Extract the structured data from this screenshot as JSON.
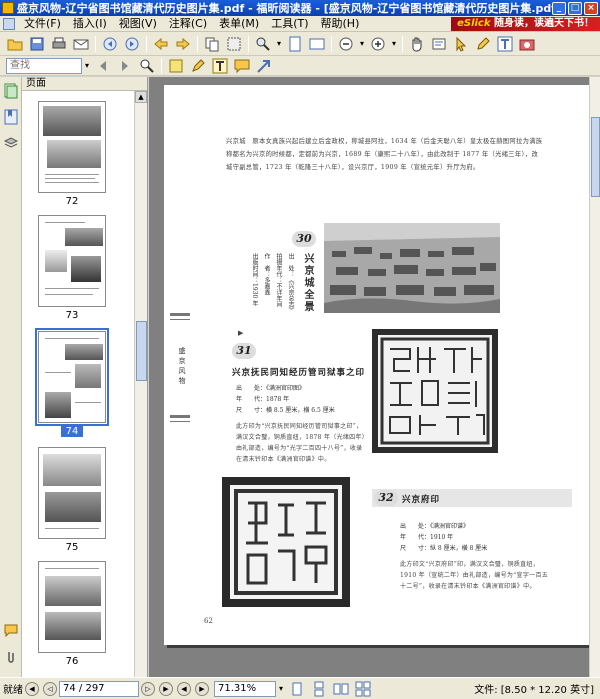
{
  "window": {
    "title": "盛京风物-辽宁省图书馆藏清代历史图片集.pdf - 福昕阅读器 - [盛京风物-辽宁省图书馆藏清代历史图片集.pdf]",
    "minimize": "_",
    "maximize": "□",
    "close": "×"
  },
  "menu": {
    "items": [
      "文件(F)",
      "插入(I)",
      "视图(V)",
      "注释(C)",
      "表单(M)",
      "工具(T)",
      "帮助(H)"
    ],
    "promo_brand": "eSlick",
    "promo_text": "随身读，读遍天下书！"
  },
  "toolbar": {
    "find_placeholder": "查找"
  },
  "left_panel": {
    "header": "页面",
    "thumbnails": [
      {
        "label": "72"
      },
      {
        "label": "73"
      },
      {
        "label": "74"
      },
      {
        "label": "75"
      },
      {
        "label": "76"
      }
    ],
    "selected_index": 2
  },
  "page": {
    "intro_paragraph": "兴京城　原本女真族兴起后建立后金政权，称城县阿拉，1634 年（后金天聪八年）皇太极在赫图阿拉为满族称都名为兴京的时候都，定都前为兴京，1689 年（康熙二十八年），由此改制于 1877 年（光绪三年），改城守副总管，1723 年（乾隆三十八年），设兴京厅，1909 年（宣统元年）升厅为府。",
    "item30": {
      "number": "30",
      "title": "兴京城全景",
      "meta_vertical": [
        "出　处：《兴京总志》",
        "拍摄年代：不详年间",
        "作　者：多嘉鑫",
        "出版时间：1930 年"
      ]
    },
    "item31": {
      "number": "31",
      "title": "兴京抚民同知经历管司狱事之印",
      "meta": [
        "出　　处：《满洲官印图》",
        "年　　代：1878 年",
        "尺　　寸：横 8.5 厘米，横 6.5 厘米"
      ],
      "description": "此方印为“兴京抚民同知经历管司狱事之印”，满汉文合璧，铜质直纽，1878 年（光绪四年）由礼部造，编号为“光字二百四十八号”，收录在清末钤印本《满洲官印谱》中。"
    },
    "item32": {
      "number": "32",
      "title": "兴京府印",
      "meta": [
        "出　　处：《满洲官印谱》",
        "年　　代：1910 年",
        "尺　　寸：纵 8 厘米，横 8 厘米"
      ],
      "description": "此方印文“兴京府印”印，满汉文合璧，铜质直纽，1910 年（宣统二年）由礼部造，编号为“宣字一百五十二号”，收录在清末钤印本《满洲官印谱》中。"
    },
    "side_label": "盛京风物",
    "page_number": "62"
  },
  "status": {
    "ready": "就绪",
    "page_display": "74 / 297",
    "zoom": "71.31%",
    "doc_size": "文件: [8.50 * 12.20 英寸]"
  },
  "colors": {
    "titlebar": "#0a3fb0",
    "accent": "#3b6fd6",
    "workspace": "#808080"
  }
}
